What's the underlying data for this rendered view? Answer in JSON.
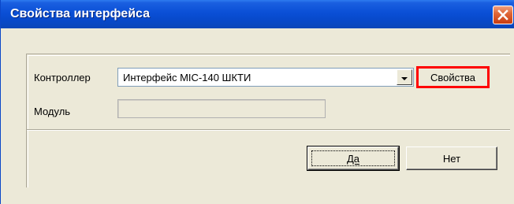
{
  "window": {
    "title": "Свойства интерфейса"
  },
  "form": {
    "controller_label": "Контроллер",
    "controller_value": "Интерфейс MIC-140 ШКТИ",
    "properties_button": "Свойства",
    "module_label": "Модуль",
    "module_value": ""
  },
  "buttons": {
    "ok": "Да",
    "cancel": "Нет"
  },
  "colors": {
    "titlebar": "#0a4fd6",
    "highlight": "#ff0000",
    "dialog_bg": "#ece9d8"
  },
  "icons": {
    "close": "close-icon",
    "dropdown": "chevron-down-icon"
  }
}
